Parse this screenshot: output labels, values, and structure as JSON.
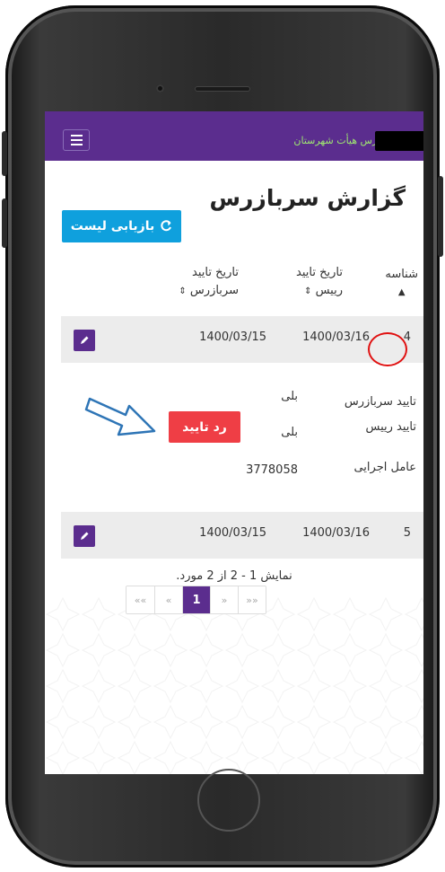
{
  "navbar": {
    "brand_text": "بازرس هیأت شهرستان"
  },
  "page": {
    "title": "گزارش سربازرس"
  },
  "toolbar": {
    "refresh_label": "بازیابی لیست"
  },
  "table": {
    "headers": {
      "id": "شناسه",
      "raees_line1": "تاریخ تایید",
      "raees_line2": "رییس",
      "sarbazras_line1": "تاریخ تایید",
      "sarbazras_line2": "سربازرس"
    },
    "rows": [
      {
        "id": "4",
        "raees_date": "1400/03/16",
        "sarbazras_date": "1400/03/15"
      },
      {
        "id": "5",
        "raees_date": "1400/03/16",
        "sarbazras_date": "1400/03/15"
      }
    ]
  },
  "detail": {
    "sarbazras_label": "تایید سربازرس",
    "sarbazras_value": "بلی",
    "raees_label": "تایید رییس",
    "raees_value": "بلی",
    "reject_label": "رد تایید",
    "agent_label": "عامل اجرایی",
    "agent_value": "3778058"
  },
  "pagination": {
    "summary": "نمایش 1 - 2 از 2 مورد.",
    "first": "««",
    "prev": "«",
    "current": "1",
    "next": "»",
    "last": "»»"
  },
  "colors": {
    "primary": "#5b2d8e",
    "refresh": "#0fa0dd",
    "danger": "#ef3e45",
    "brand_text": "#9fe870",
    "annotation_red": "#e01010",
    "annotation_arrow": "#2e75b6"
  },
  "icons": {
    "refresh": "refresh-icon",
    "edit": "pencil-icon",
    "menu": "hamburger-icon",
    "sort": "sort-icon"
  }
}
